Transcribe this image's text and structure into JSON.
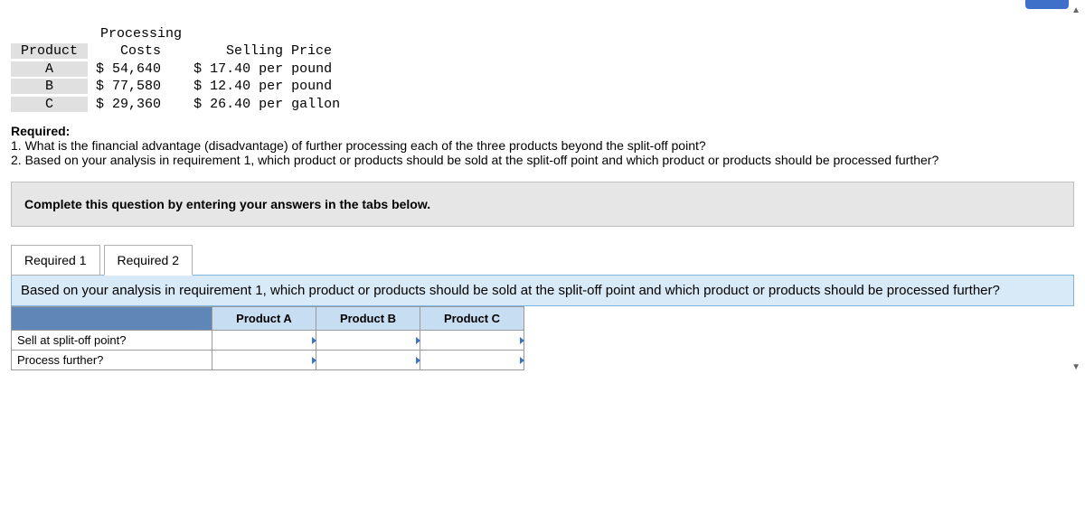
{
  "table": {
    "headers": {
      "product": "Product",
      "costs": "Processing\nCosts",
      "price": "Selling Price"
    },
    "rows": [
      {
        "product": "A",
        "costs": "$ 54,640",
        "price": "$ 17.40 per pound"
      },
      {
        "product": "B",
        "costs": "$ 77,580",
        "price": "$ 12.40 per pound"
      },
      {
        "product": "C",
        "costs": "$ 29,360",
        "price": "$ 26.40 per gallon"
      }
    ]
  },
  "required": {
    "title": "Required:",
    "q1": "1. What is the financial advantage (disadvantage) of further processing each of the three products beyond the split-off point?",
    "q2": "2. Based on your analysis in requirement 1, which product or products should be sold at the split-off point and which product or products should be processed further?"
  },
  "instruction": "Complete this question by entering your answers in the tabs below.",
  "tabs": {
    "t1": "Required 1",
    "t2": "Required 2"
  },
  "panel": {
    "question": "Based on your analysis in requirement 1, which product or products should be sold at the split-off point and which product or products should be processed further?",
    "cols": {
      "a": "Product A",
      "b": "Product B",
      "c": "Product C"
    },
    "rows": {
      "r1": "Sell at split-off point?",
      "r2": "Process further?"
    }
  },
  "scroll": {
    "up": "▲",
    "down": "▼"
  }
}
